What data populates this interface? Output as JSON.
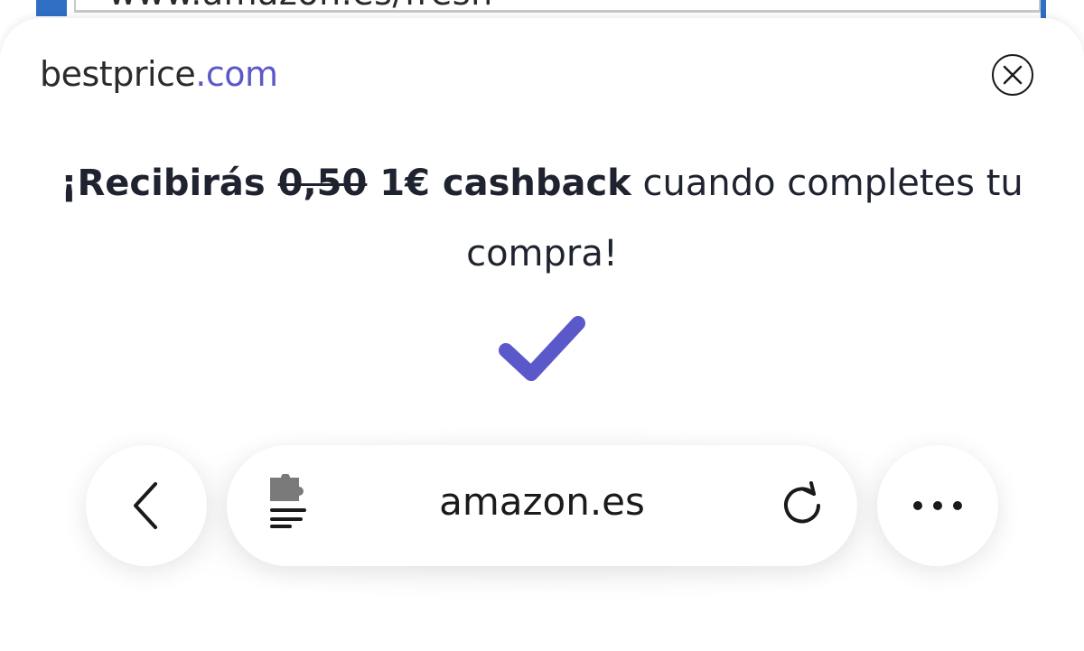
{
  "background": {
    "url_text": "www.amazon.es/fresh"
  },
  "sheet": {
    "logo_main": "bestprice",
    "logo_tld": ".com",
    "message": {
      "prefix": "¡Recibirás ",
      "old_amount": "0,50",
      "new_amount": " 1€ cashback",
      "suffix": " cuando completes tu compra!"
    }
  },
  "toolbar": {
    "url": "amazon.es"
  },
  "icons": {
    "close": "close-icon",
    "check": "checkmark-icon",
    "back": "chevron-left-icon",
    "extension": "puzzle-extension-icon",
    "reload": "reload-icon",
    "more": "more-dots-icon"
  },
  "colors": {
    "brand": "#5b59c9",
    "check": "#5b59c9",
    "text": "#1f2330"
  }
}
